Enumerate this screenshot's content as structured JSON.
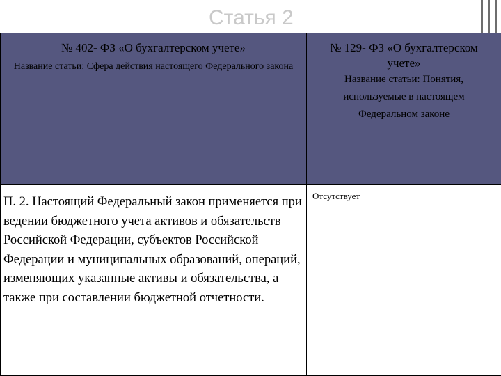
{
  "slide": {
    "title": "Статья 2"
  },
  "table": {
    "left_header": {
      "law": "№ 402- ФЗ «О бухгалтерском учете»",
      "article_label": "Название статьи:",
      "article_name": "Сфера действия настоящего Федерального закона"
    },
    "right_header": {
      "law": "№ 129- ФЗ «О бухгалтерском учете»",
      "article_label": "Название статьи:",
      "article_name": "Понятия, используемые в настоящем Федеральном законе"
    },
    "left_body": "П. 2. Настоящий Федеральный закон применяется при ведении бюджетного учета активов и обязательств Российской Федерации, субъектов Российской Федерации и муниципальных образований, операций, изменяющих указанные активы и обязательства, а также при составлении бюджетной отчетности.",
    "right_body": "Отсутствует"
  },
  "colors": {
    "header_background": "#55577f",
    "body_background": "#ffffff",
    "title_color": "#c9c9c9",
    "border": "#000000",
    "accent_bars": "#6e6e6e"
  }
}
